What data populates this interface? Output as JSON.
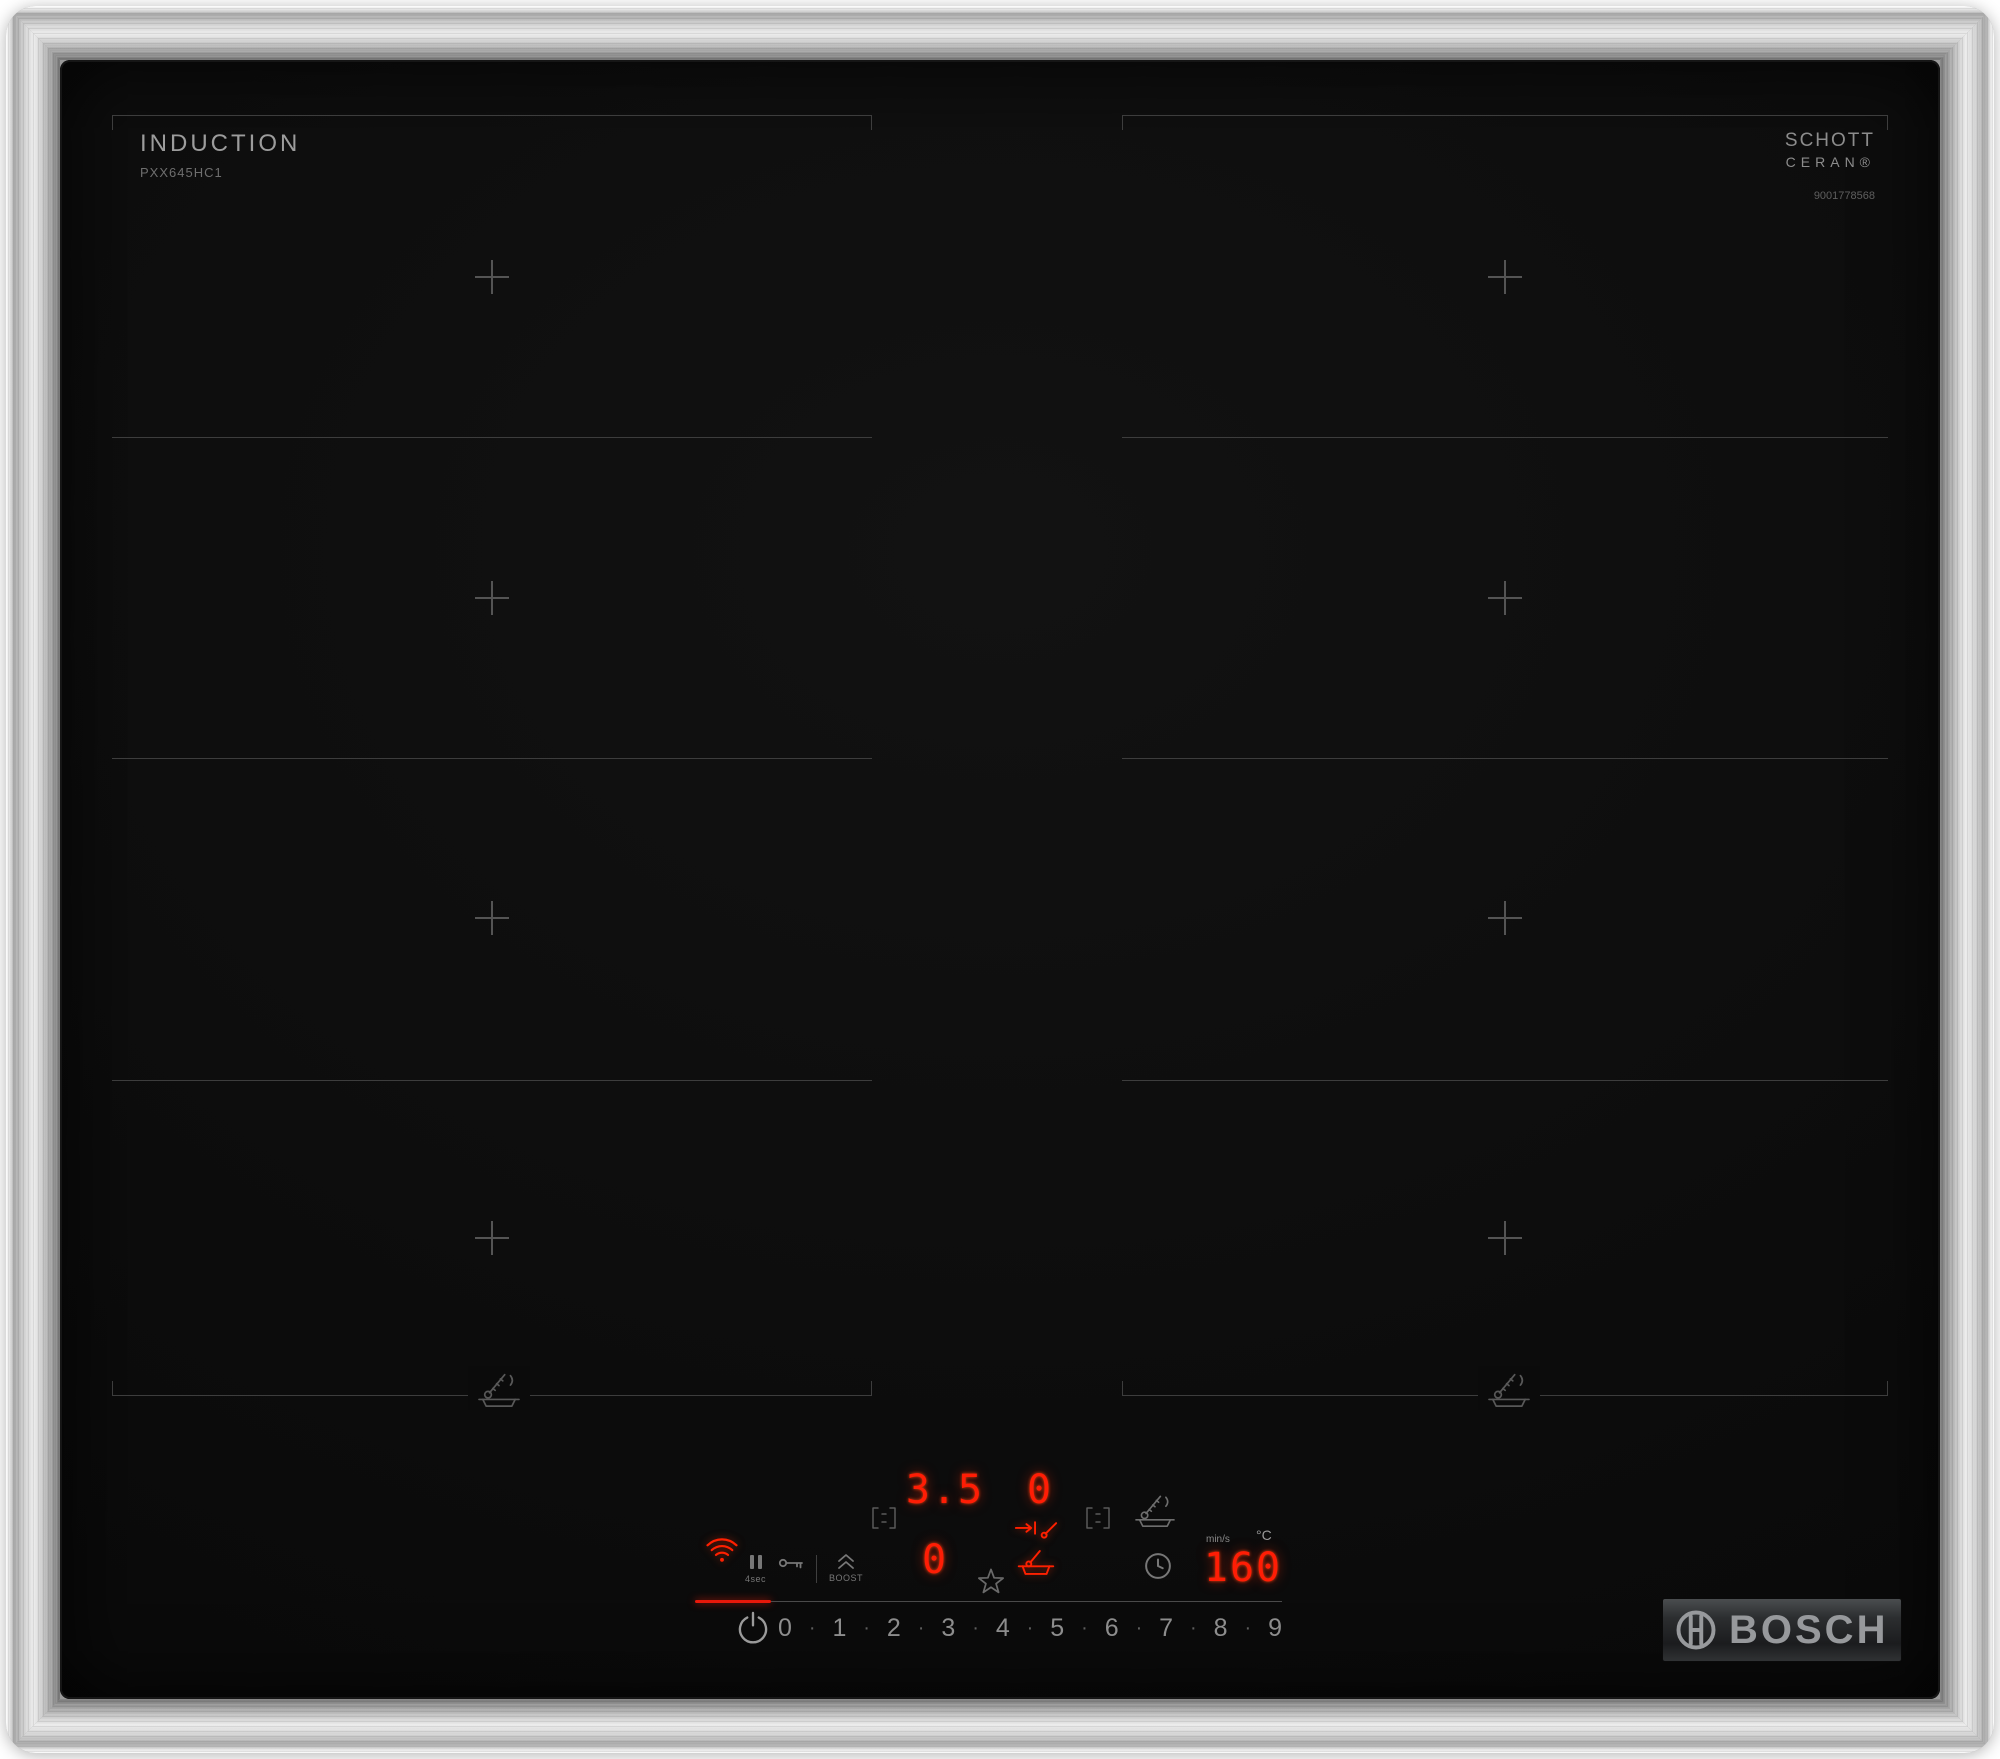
{
  "header": {
    "title": "INDUCTION",
    "model": "PXX645HC1",
    "brand_line1": "SCHOTT",
    "brand_line2": "CERAN®",
    "serial": "9001778568"
  },
  "logo": {
    "text": "BOSCH"
  },
  "panel": {
    "display_left_top": "3.5",
    "display_right_top": "0",
    "display_left_bottom": "0",
    "display_timer": "160",
    "unit_time": "min/s",
    "unit_temp": "°C",
    "pause_label": "4sec",
    "boost_label": "BOOST",
    "digits": [
      "0",
      "1",
      "2",
      "3",
      "4",
      "5",
      "6",
      "7",
      "8",
      "9"
    ],
    "separator": "·"
  },
  "colors": {
    "led_red": "#ff1d05",
    "marking_gray": "#3d3d3d",
    "glass_black": "#0b0b0b",
    "steel": "#c4c4c4"
  },
  "icons": {
    "wifi": "wifi-icon",
    "pause": "pause-icon",
    "key": "key-lock-icon",
    "boost": "boost-icon",
    "flex_zone_left": "flex-zone-left-icon",
    "flex_zone_right": "flex-zone-right-icon",
    "favorite": "star-icon",
    "move_pan": "move-pan-icon",
    "fry_sensor": "fry-sensor-icon",
    "timer": "clock-icon",
    "power": "power-icon",
    "bosch_symbol": "bosch-anchor-icon"
  }
}
